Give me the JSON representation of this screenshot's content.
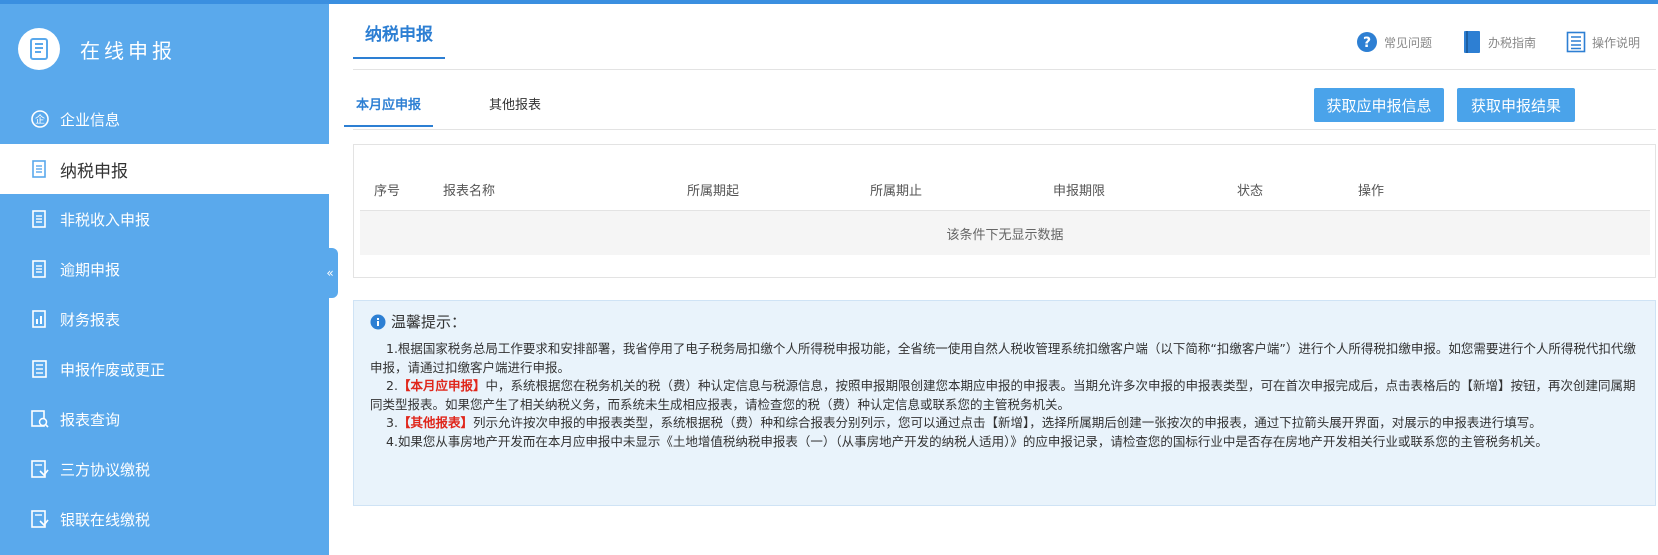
{
  "colors": {
    "accent": "#2d7fd3",
    "sidebar": "#5aa9ec",
    "button": "#4aa3ea",
    "highlight": "#e0261b"
  },
  "sidebar": {
    "title": "在线申报",
    "items": [
      {
        "label": "企业信息",
        "icon": "enterprise-icon"
      },
      {
        "label": "纳税申报",
        "icon": "document-icon",
        "active": true
      },
      {
        "label": "非税收入申报",
        "icon": "document-icon"
      },
      {
        "label": "逾期申报",
        "icon": "document-icon"
      },
      {
        "label": "财务报表",
        "icon": "report-icon"
      },
      {
        "label": "申报作废或更正",
        "icon": "list-icon"
      },
      {
        "label": "报表查询",
        "icon": "search-doc-icon"
      },
      {
        "label": "三方协议缴税",
        "icon": "agreement-icon"
      },
      {
        "label": "银联在线缴税",
        "icon": "agreement-icon"
      }
    ],
    "collapse_glyph": "«"
  },
  "header": {
    "title": "纳税申报",
    "links": [
      {
        "label": "常见问题",
        "icon": "question-icon"
      },
      {
        "label": "办税指南",
        "icon": "book-icon"
      },
      {
        "label": "操作说明",
        "icon": "list-doc-icon"
      }
    ]
  },
  "tabs": [
    {
      "label": "本月应申报",
      "active": true
    },
    {
      "label": "其他报表",
      "active": false
    }
  ],
  "buttons": {
    "fetch_info": "获取应申报信息",
    "fetch_result": "获取申报结果"
  },
  "table": {
    "columns": [
      "序号",
      "报表名称",
      "所属期起",
      "所属期止",
      "申报期限",
      "状态",
      "操作"
    ],
    "empty_text": "该条件下无显示数据"
  },
  "tips": {
    "title": "温馨提示：",
    "p1": "1.根据国家税务总局工作要求和安排部署，我省停用了电子税务局扣缴个人所得税申报功能，全省统一使用自然人税收管理系统扣缴客户端（以下简称“扣缴客户端”）进行个人所得税扣缴申报。如您需要进行个人所得税代扣代缴申报，请通过扣缴客户端进行申报。",
    "p2_prefix": "2.",
    "p2_highlight": "【本月应申报】",
    "p2_text": "中，系统根据您在税务机关的税（费）种认定信息与税源信息，按照申报期限创建您本期应申报的申报表。当期允许多次申报的申报表类型，可在首次申报完成后，点击表格后的【新增】按钮，再次创建同属期同类型报表。如果您产生了相关纳税义务，而系统未生成相应报表，请检查您的税（费）种认定信息或联系您的主管税务机关。",
    "p3_prefix": "3.",
    "p3_highlight": "【其他报表】",
    "p3_text": "列示允许按次申报的申报表类型，系统根据税（费）种和综合报表分别列示，您可以通过点击【新增】，选择所属期后创建一张按次的申报表，通过下拉箭头展开界面，对展示的申报表进行填写。",
    "p4": "4.如果您从事房地产开发而在本月应申报中未显示《土地增值税纳税申报表（一）（从事房地产开发的纳税人适用）》的应申报记录，请检查您的国标行业中是否存在房地产开发相关行业或联系您的主管税务机关。"
  }
}
